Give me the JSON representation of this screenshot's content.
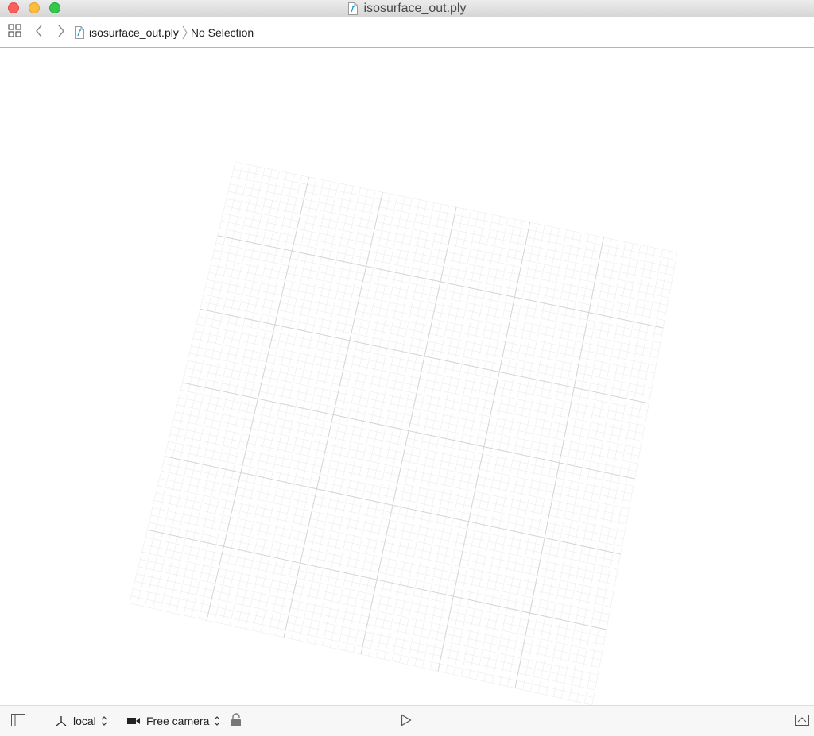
{
  "window": {
    "title": "isosurface_out.ply"
  },
  "jumpbar": {
    "file_name": "isosurface_out.ply",
    "selection": "No Selection"
  },
  "bottombar": {
    "coordinate_space": "local",
    "camera": "Free camera"
  },
  "icons": {
    "close": "close-window-icon",
    "minimize": "minimize-window-icon",
    "zoom": "zoom-window-icon",
    "file": "ply-file-icon",
    "grid": "related-items-grid-icon",
    "back": "chevron-left-icon",
    "forward": "chevron-right-icon",
    "sidebar": "sidebar-toggle-icon",
    "axis": "coordinate-axis-icon",
    "camera": "video-camera-icon",
    "lock": "unlock-icon",
    "play": "play-icon",
    "panel": "panel-toggle-icon",
    "stepper": "up-down-stepper-icon"
  },
  "colors": {
    "close": "#fc605c",
    "minimize": "#fdbc40",
    "zoom": "#34c84a",
    "file_accent": "#1d9bd1",
    "grid_major": "#d4d4d4",
    "grid_minor": "#ececec"
  }
}
